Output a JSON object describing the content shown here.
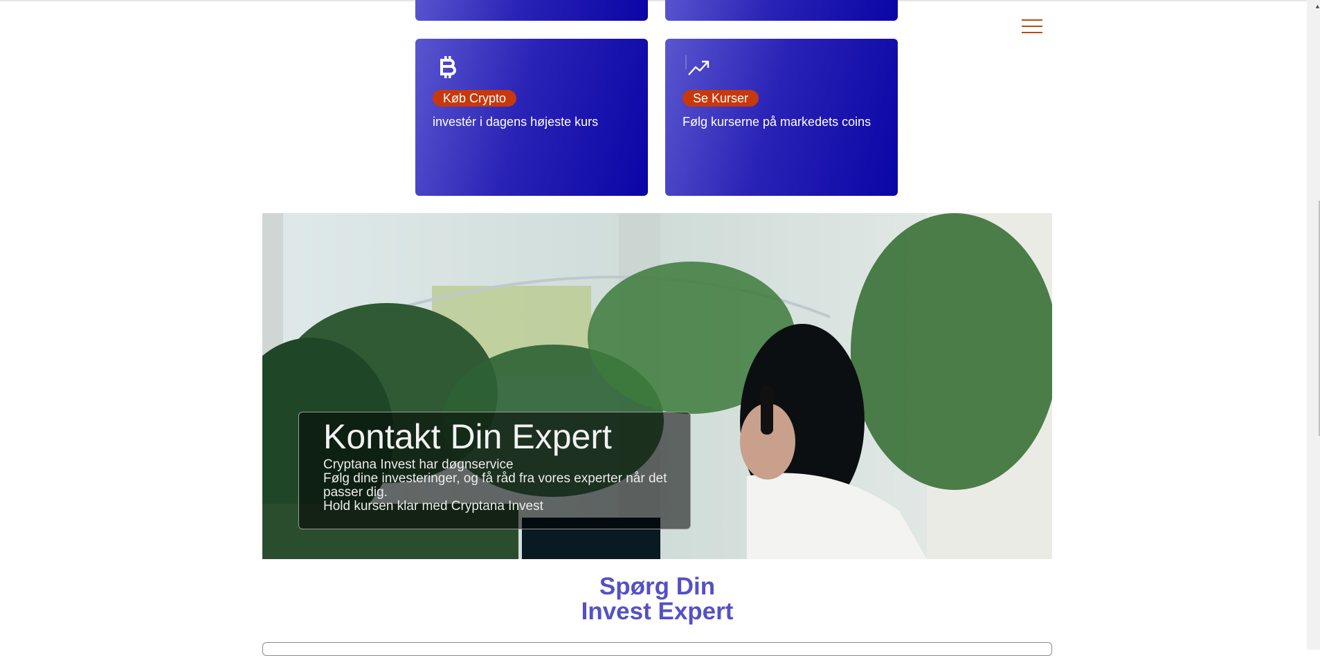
{
  "cards": [
    {
      "icon": "bitcoin-icon",
      "badge": "Køb Crypto",
      "desc": "investér i dagens højeste kurs"
    },
    {
      "icon": "trending-up-icon",
      "badge": "Se Kurser",
      "desc": "Følg kurserne på markedets coins"
    }
  ],
  "nav": {
    "menu_icon": "hamburger-menu-icon"
  },
  "hero": {
    "title": "Kontakt Din Expert",
    "line1": "Cryptana Invest har døgnservice",
    "line2": "Følg dine investeringer, og få råd fra vores experter når det passer dig.",
    "line3": "Hold kursen klar med Cryptana Invest"
  },
  "ask": {
    "line1": "Spørg Din",
    "line2": "Invest Expert"
  },
  "colors": {
    "card_start": "#5a56cf",
    "card_end": "#0a05a6",
    "badge": "#c8380d",
    "heading": "#5550c6",
    "menu": "#c0480f"
  }
}
